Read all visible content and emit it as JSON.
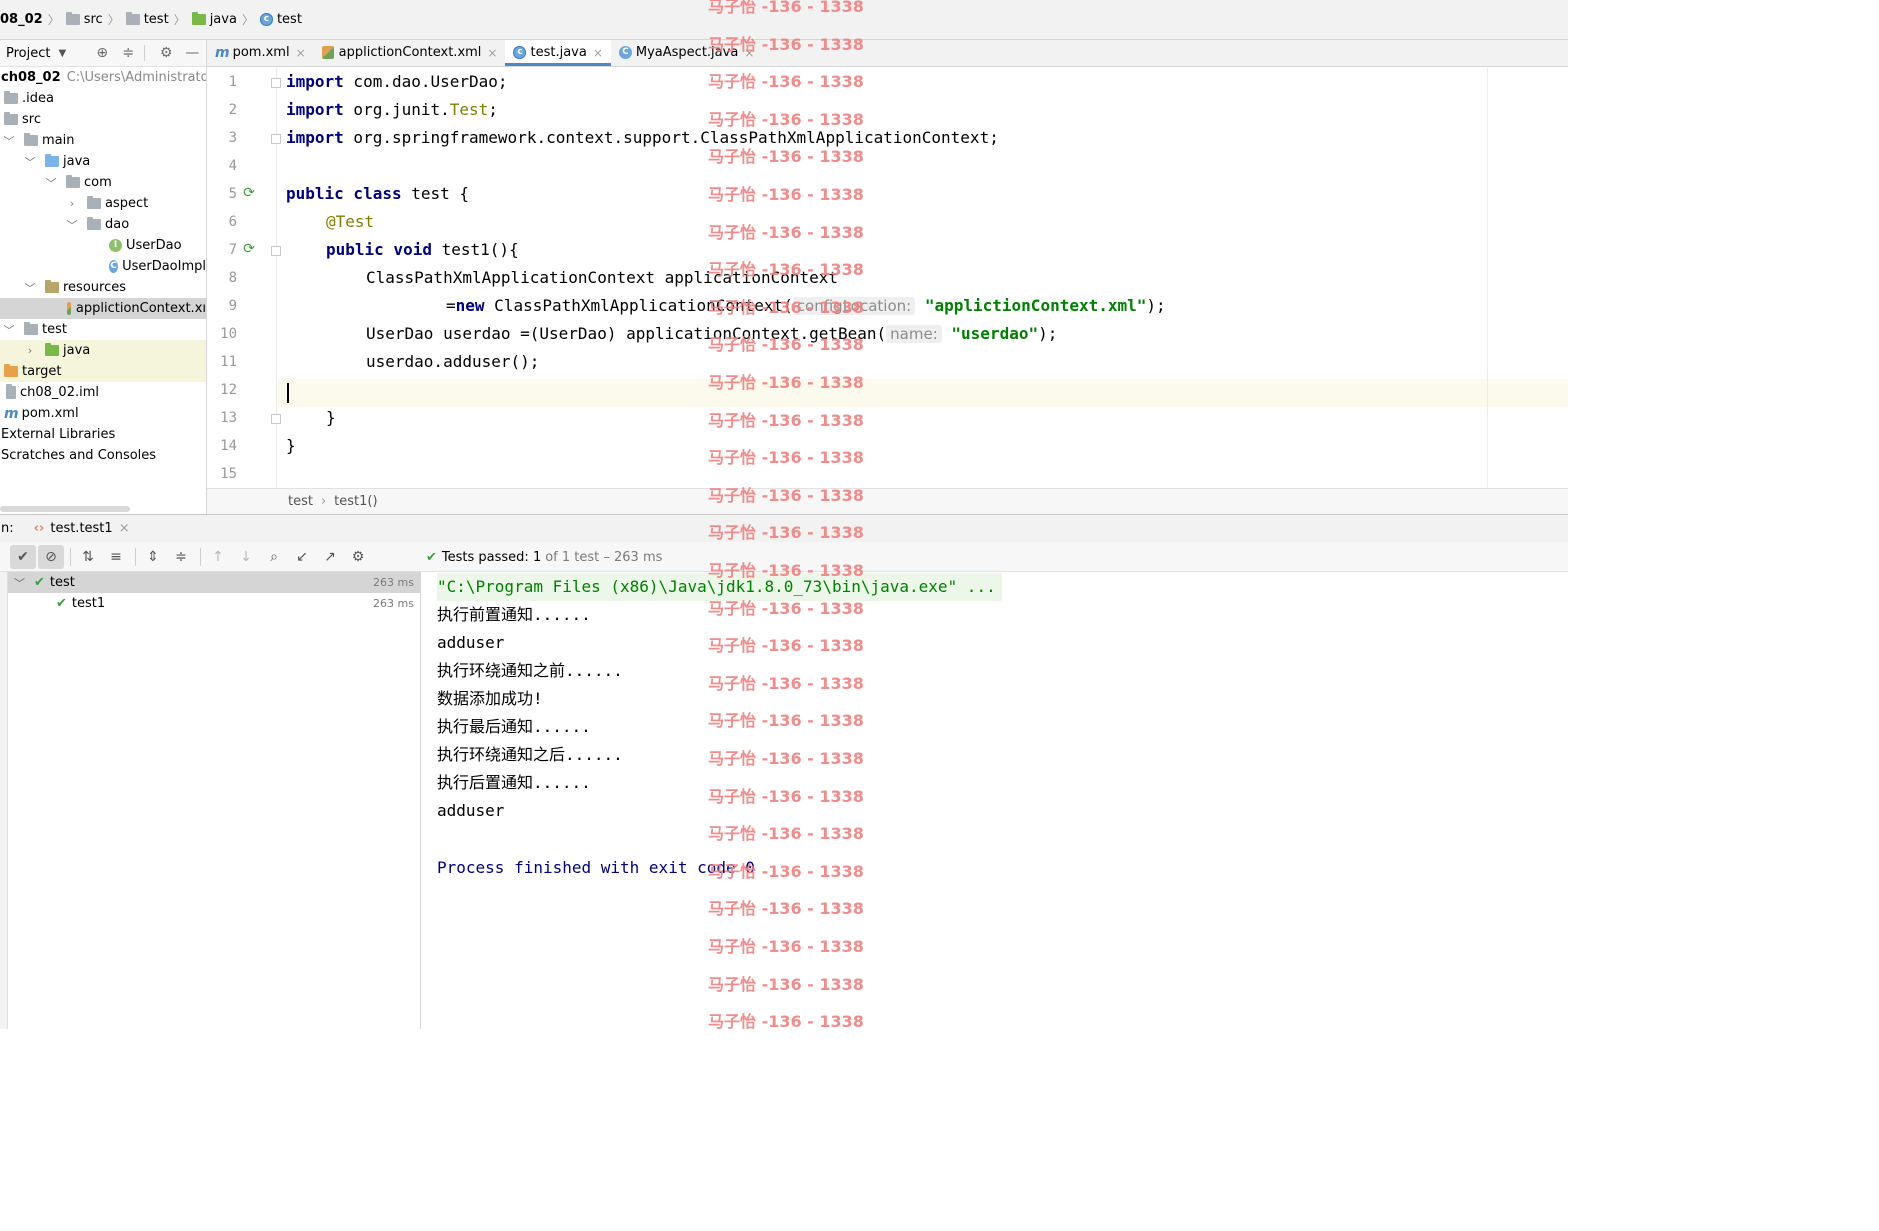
{
  "navbar": {
    "crumbs": [
      "08_02",
      "src",
      "test",
      "java",
      "test"
    ]
  },
  "project": {
    "title": "Project",
    "root_name": "ch08_02",
    "root_path": "C:\\Users\\Administrator\\I",
    "items": [
      ".idea",
      "src",
      "main",
      "java",
      "com",
      "aspect",
      "dao",
      "UserDao",
      "UserDaoImpl",
      "resources",
      "applictionContext.xı",
      "test",
      "java",
      "target",
      "ch08_02.iml",
      "pom.xml",
      "External Libraries",
      "Scratches and Consoles"
    ]
  },
  "tabs": [
    {
      "label": "pom.xml",
      "icon": "maven-icon"
    },
    {
      "label": "applictionContext.xml",
      "icon": "xml-icon"
    },
    {
      "label": "test.java",
      "icon": "class-icon"
    },
    {
      "label": "MyaAspect.java",
      "icon": "class-icon"
    }
  ],
  "code": {
    "line_numbers": [
      "1",
      "2",
      "3",
      "4",
      "5",
      "6",
      "7",
      "8",
      "9",
      "10",
      "11",
      "12",
      "13",
      "14",
      "15"
    ],
    "l1_kw": "import",
    "l1_rest": " com.dao.UserDao;",
    "l2_kw": "import",
    "l2_rest_a": " org.junit.",
    "l2_ann": "Test",
    "l2_rest_b": ";",
    "l3_kw": "import",
    "l3_rest": " org.springframework.context.support.ClassPathXmlApplicationContext;",
    "l5_kw": "public class",
    "l5_rest": " test {",
    "l6_ann": "@Test",
    "l7_kw": "public void",
    "l7_rest": " test1(){",
    "l8": "ClassPathXmlApplicationContext applicationContext",
    "l9_a": "=",
    "l9_kw": "new",
    "l9_b": " ClassPathXmlApplicationContext(",
    "l9_hint": "configLocation:",
    "l9_str": "\"applictionContext.xml\"",
    "l9_c": ");",
    "l10_a": "UserDao userdao =(UserDao) applicationContext.getBean(",
    "l10_hint": "name:",
    "l10_str": "\"userdao\"",
    "l10_b": ");",
    "l11": "userdao.adduser();",
    "l13": "}",
    "l14": "}"
  },
  "editor_breadcrumb": {
    "class": "test",
    "method": "test1()"
  },
  "run": {
    "prefix": "n:",
    "tab_label": "test.test1",
    "status_bold": "Tests passed: 1",
    "status_dim": "of 1 test – 263 ms",
    "tree": [
      {
        "label": "test",
        "time": "263 ms"
      },
      {
        "label": "test1",
        "time": "263 ms"
      }
    ]
  },
  "console": {
    "cmd": "\"C:\\Program Files (x86)\\Java\\jdk1.8.0_73\\bin\\java.exe\" ...",
    "lines": [
      "执行前置通知......",
      "adduser",
      "执行环绕通知之前......",
      "数据添加成功!",
      "执行最后通知......",
      "执行环绕通知之后......",
      "执行后置通知......",
      "adduser"
    ],
    "exit": "Process finished with exit code 0"
  },
  "watermark": {
    "text": "马子怡 -136 - 1338"
  },
  "colors": {
    "keyword": "#000080",
    "string": "#008000",
    "annotation": "#808000",
    "watermark": "#f08080",
    "pass": "#3f9d3f"
  }
}
